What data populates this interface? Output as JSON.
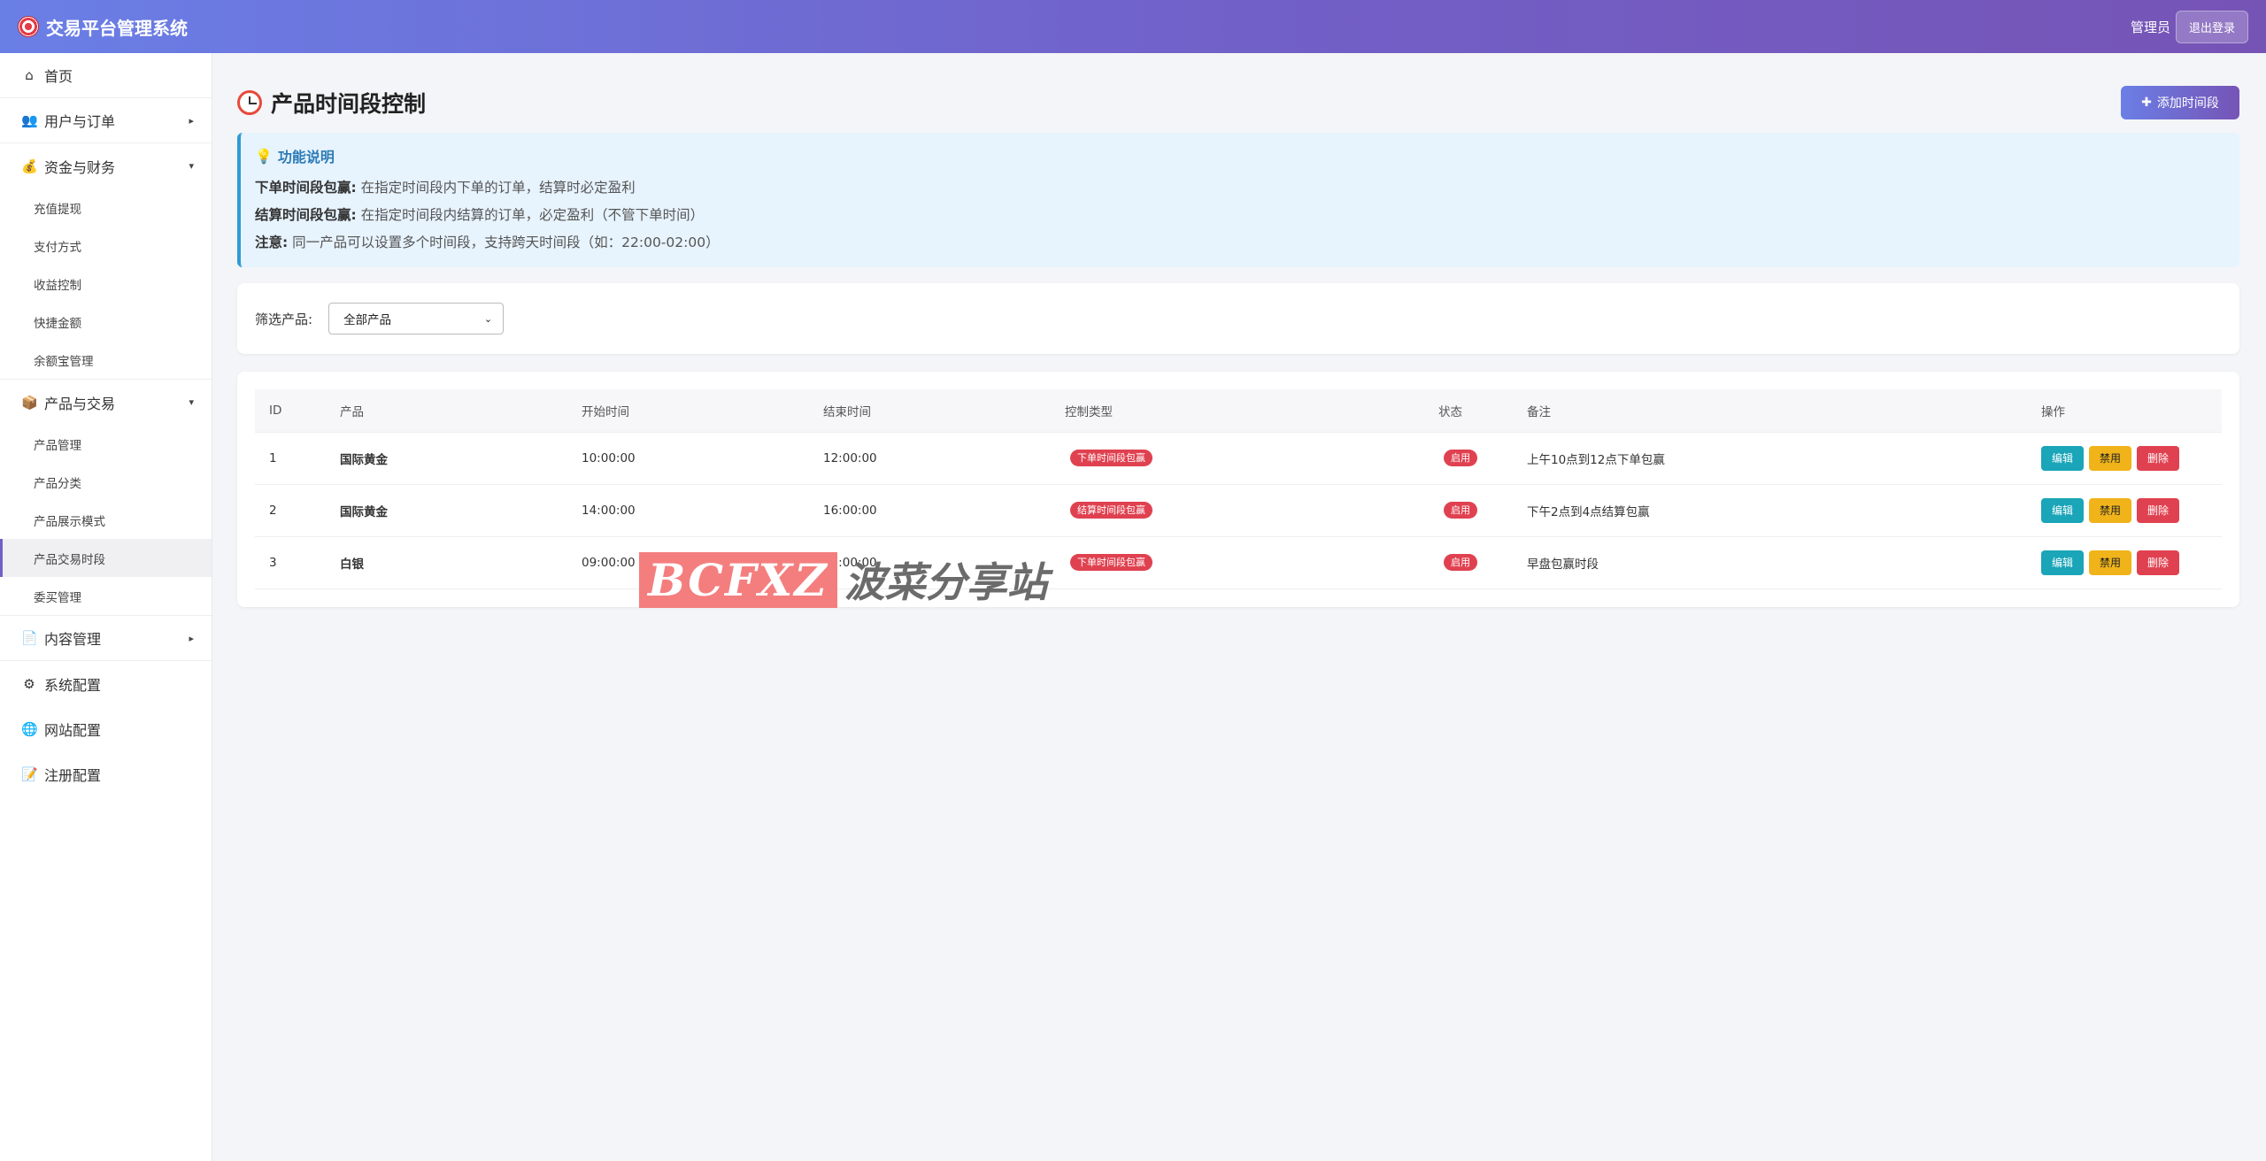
{
  "header": {
    "app_title": "交易平台管理系统",
    "user_label": "管理员",
    "logout_label": "退出登录"
  },
  "sidebar": {
    "items": [
      {
        "label": "首页",
        "icon": "home-icon",
        "caret": ""
      },
      {
        "label": "用户与订单",
        "icon": "users-icon",
        "caret": "▸"
      },
      {
        "label": "资金与财务",
        "icon": "money-bag-icon",
        "caret": "▾",
        "children": [
          "充值提现",
          "支付方式",
          "收益控制",
          "快捷金额",
          "余额宝管理"
        ]
      },
      {
        "label": "产品与交易",
        "icon": "package-icon",
        "caret": "▾",
        "children": [
          "产品管理",
          "产品分类",
          "产品展示模式",
          "产品交易时段",
          "委买管理"
        ]
      },
      {
        "label": "内容管理",
        "icon": "document-icon",
        "caret": "▸"
      },
      {
        "label": "系统配置",
        "icon": "gear-icon",
        "caret": ""
      },
      {
        "label": "网站配置",
        "icon": "globe-icon",
        "caret": ""
      },
      {
        "label": "注册配置",
        "icon": "memo-icon",
        "caret": ""
      }
    ]
  },
  "page": {
    "title": "产品时间段控制",
    "add_button": "添加时间段"
  },
  "info": {
    "title": "功能说明",
    "lines": [
      {
        "label": "下单时间段包赢:",
        "text": "在指定时间段内下单的订单，结算时必定盈利"
      },
      {
        "label": "结算时间段包赢:",
        "text": "在指定时间段内结算的订单，必定盈利（不管下单时间）"
      },
      {
        "label": "注意:",
        "text": "同一产品可以设置多个时间段，支持跨天时间段（如：22:00-02:00）"
      }
    ]
  },
  "filter": {
    "label": "筛选产品:",
    "selected": "全部产品"
  },
  "table": {
    "headers": [
      "ID",
      "产品",
      "开始时间",
      "结束时间",
      "控制类型",
      "状态",
      "备注",
      "操作"
    ],
    "rows": [
      {
        "id": "1",
        "product": "国际黄金",
        "start": "10:00:00",
        "end": "12:00:00",
        "type": "下单时间段包赢",
        "status": "启用",
        "note": "上午10点到12点下单包赢"
      },
      {
        "id": "2",
        "product": "国际黄金",
        "start": "14:00:00",
        "end": "16:00:00",
        "type": "结算时间段包赢",
        "status": "启用",
        "note": "下午2点到4点结算包赢"
      },
      {
        "id": "3",
        "product": "白银",
        "start": "09:00:00",
        "end": "11:00:00",
        "type": "下单时间段包赢",
        "status": "启用",
        "note": "早盘包赢时段"
      }
    ],
    "actions": {
      "edit": "编辑",
      "disable": "禁用",
      "delete": "删除"
    }
  },
  "watermark": {
    "logo": "BCFXZ",
    "text": "波菜分享站"
  }
}
